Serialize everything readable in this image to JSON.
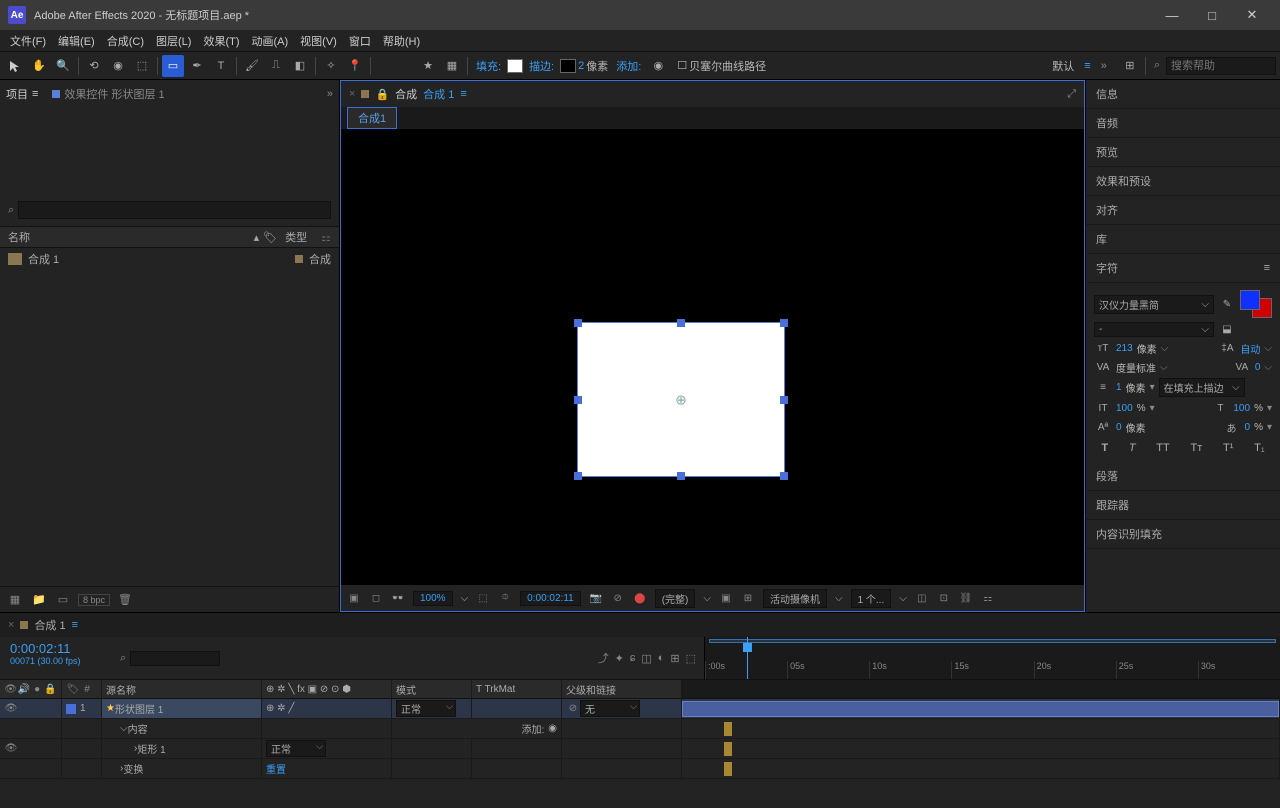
{
  "titlebar": {
    "app": "Adobe After Effects 2020",
    "file": "无标题项目.aep *"
  },
  "menu": [
    "文件(F)",
    "编辑(E)",
    "合成(C)",
    "图层(L)",
    "效果(T)",
    "动画(A)",
    "视图(V)",
    "窗口",
    "帮助(H)"
  ],
  "toolbar": {
    "fill_label": "填充:",
    "stroke_label": "描边:",
    "stroke_px": "2",
    "px": "像素",
    "add_label": "添加:",
    "bezier": "贝塞尔曲线路径",
    "default": "默认",
    "search_ph": "搜索帮助"
  },
  "project": {
    "tab1": "项目",
    "tab2": "效果控件 形状图层 1",
    "col_name": "名称",
    "col_type": "类型",
    "item_name": "合成 1",
    "item_type": "合成",
    "bpc": "8 bpc"
  },
  "comp": {
    "label": "合成",
    "name": "合成 1",
    "tab": "合成1",
    "zoom": "100%",
    "time": "0:00:02:11",
    "res": "(完整)",
    "cam": "活动摄像机",
    "views": "1 个..."
  },
  "panels": {
    "info": "信息",
    "audio": "音频",
    "preview": "预览",
    "effects": "效果和预设",
    "align": "对齐",
    "lib": "库",
    "char": "字符",
    "para": "段落",
    "tracker": "跟踪器",
    "caf": "内容识别填充"
  },
  "char": {
    "font": "汉仪力量黑简",
    "style": "-",
    "size": "213",
    "size_u": "像素",
    "leading": "自动",
    "kerning": "度量标准",
    "tracking": "0",
    "strokew": "1",
    "stroke_u": "像素",
    "strokeopt": "在填充上描边",
    "vscale": "100",
    "vscale_u": "%",
    "hscale": "100",
    "hscale_u": "%",
    "baseline": "0",
    "baseline_u": "像素",
    "tsume": "0",
    "tsume_u": "%"
  },
  "timeline": {
    "tab": "合成 1",
    "time": "0:00:02:11",
    "fps": "00071 (30.00 fps)",
    "ticks": [
      ":00s",
      "05s",
      "10s",
      "15s",
      "20s",
      "25s",
      "30s"
    ],
    "col_src": "源名称",
    "col_mode": "模式",
    "col_trkmat": "T TrkMat",
    "col_parent": "父级和链接",
    "layer_num": "1",
    "layer_name": "形状图层 1",
    "layer_mode": "正常",
    "layer_parent": "无",
    "contents": "内容",
    "add": "添加:",
    "rect": "矩形 1",
    "rect_mode": "正常",
    "transform": "变换",
    "reset": "重置"
  }
}
